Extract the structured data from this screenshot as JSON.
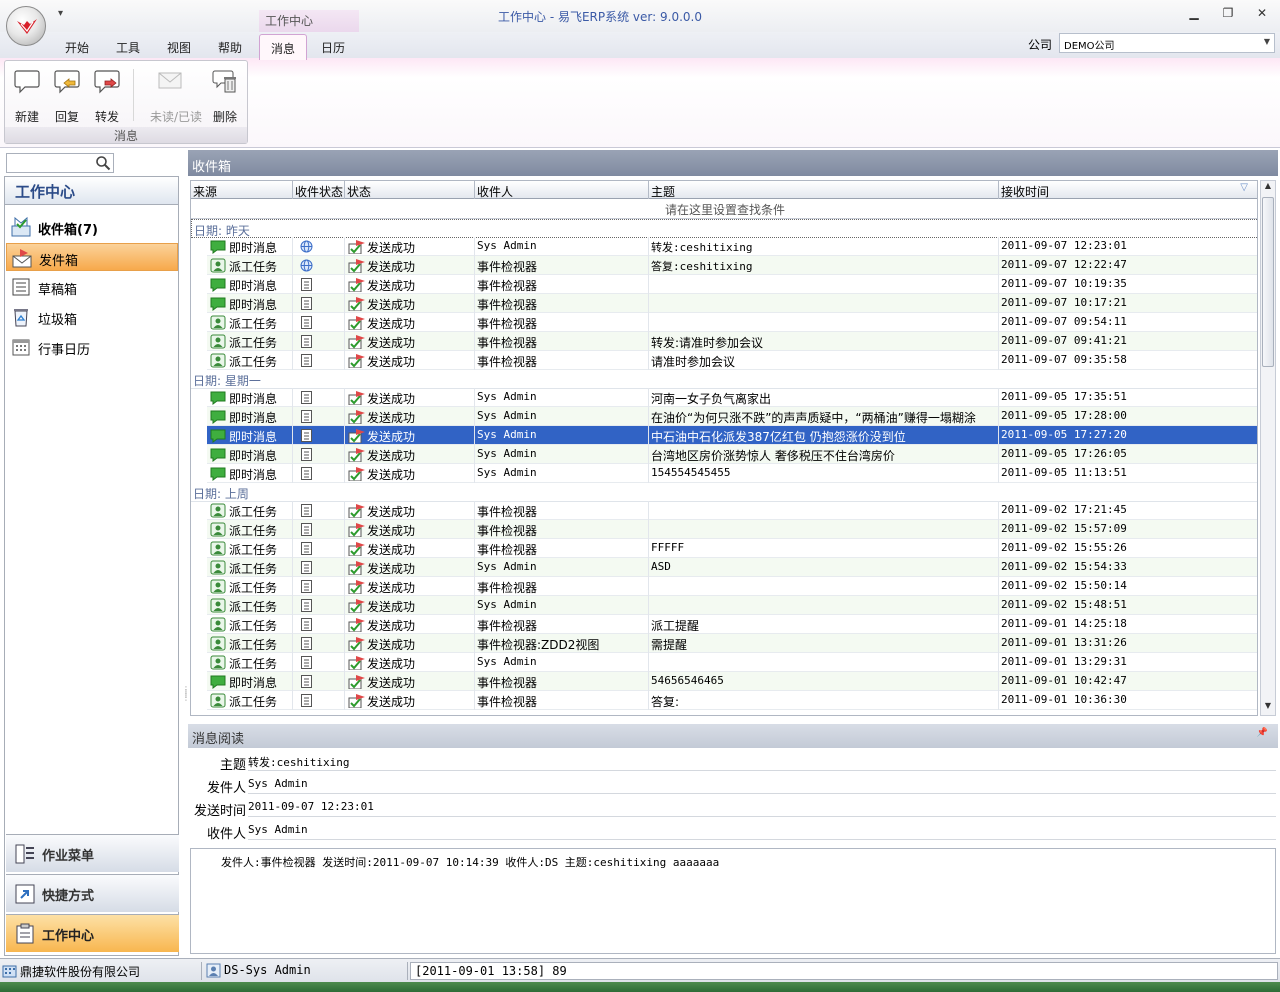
{
  "window": {
    "title": "工作中心 - 易飞ERP系统 ver: 9.0.0.0"
  },
  "ribbon": {
    "context_label": "工作中心",
    "tabs": [
      "开始",
      "工具",
      "视图",
      "帮助",
      "消息",
      "日历"
    ],
    "active_tab": "消息",
    "company_label": "公司",
    "company_value": "DEMO公司",
    "group_label": "消息",
    "buttons": {
      "new": "新建",
      "reply": "回复",
      "forward": "转发",
      "unread_read": "未读/已读",
      "delete": "删除"
    }
  },
  "nav": {
    "header": "工作中心",
    "items": [
      {
        "label": "收件箱(7)"
      },
      {
        "label": "发件箱"
      },
      {
        "label": "草稿箱"
      },
      {
        "label": "垃圾箱"
      },
      {
        "label": "行事日历"
      }
    ],
    "sections": [
      {
        "label": "作业菜单"
      },
      {
        "label": "快捷方式"
      },
      {
        "label": "工作中心"
      }
    ]
  },
  "inbox": {
    "title": "收件箱",
    "columns": [
      "来源",
      "收件状态",
      "状态",
      "收件人",
      "主题",
      "接收时间"
    ],
    "filter_hint": "请在这里设置查找条件",
    "groups": [
      {
        "label": "日期: 昨天",
        "rows": [
          {
            "src": "即时消息",
            "rs": "globe",
            "status": "发送成功",
            "receiver": "Sys Admin",
            "subject": "转发:ceshitixing",
            "time": "2011-09-07 12:23:01"
          },
          {
            "src": "派工任务",
            "rs": "globe",
            "status": "发送成功",
            "receiver": "事件检视器",
            "subject": "答复:ceshitixing",
            "time": "2011-09-07 12:22:47"
          },
          {
            "src": "即时消息",
            "rs": "doc",
            "status": "发送成功",
            "receiver": "事件检视器",
            "subject": "",
            "time": "2011-09-07 10:19:35"
          },
          {
            "src": "即时消息",
            "rs": "doc",
            "status": "发送成功",
            "receiver": "事件检视器",
            "subject": "",
            "time": "2011-09-07 10:17:21"
          },
          {
            "src": "派工任务",
            "rs": "doc",
            "status": "发送成功",
            "receiver": "事件检视器",
            "subject": "",
            "time": "2011-09-07 09:54:11"
          },
          {
            "src": "派工任务",
            "rs": "doc",
            "status": "发送成功",
            "receiver": "事件检视器",
            "subject": "转发:请准时参加会议",
            "time": "2011-09-07 09:41:21"
          },
          {
            "src": "派工任务",
            "rs": "doc",
            "status": "发送成功",
            "receiver": "事件检视器",
            "subject": "请准时参加会议",
            "time": "2011-09-07 09:35:58"
          }
        ]
      },
      {
        "label": "日期: 星期一",
        "rows": [
          {
            "src": "即时消息",
            "rs": "doc",
            "status": "发送成功",
            "receiver": "Sys Admin",
            "subject": "河南一女子负气离家出",
            "time": "2011-09-05 17:35:51"
          },
          {
            "src": "即时消息",
            "rs": "doc",
            "status": "发送成功",
            "receiver": "Sys Admin",
            "subject": "在油价“为何只涨不跌”的声声质疑中，“两桶油”赚得一塌糊涂",
            "time": "2011-09-05 17:28:00"
          },
          {
            "src": "即时消息",
            "rs": "doc",
            "status": "发送成功",
            "receiver": "Sys Admin",
            "subject": "中石油中石化派发387亿红包 仍抱怨涨价没到位",
            "time": "2011-09-05 17:27:20",
            "selected": true
          },
          {
            "src": "即时消息",
            "rs": "doc",
            "status": "发送成功",
            "receiver": "Sys Admin",
            "subject": "台湾地区房价涨势惊人 奢侈税压不住台湾房价",
            "time": "2011-09-05 17:26:05"
          },
          {
            "src": "即时消息",
            "rs": "doc",
            "status": "发送成功",
            "receiver": "Sys Admin",
            "subject": "154554545455",
            "time": "2011-09-05 11:13:51"
          }
        ]
      },
      {
        "label": "日期: 上周",
        "rows": [
          {
            "src": "派工任务",
            "rs": "doc",
            "status": "发送成功",
            "receiver": "事件检视器",
            "subject": "",
            "time": "2011-09-02 17:21:45"
          },
          {
            "src": "派工任务",
            "rs": "doc",
            "status": "发送成功",
            "receiver": "事件检视器",
            "subject": "",
            "time": "2011-09-02 15:57:09"
          },
          {
            "src": "派工任务",
            "rs": "doc",
            "status": "发送成功",
            "receiver": "事件检视器",
            "subject": "FFFFF",
            "time": "2011-09-02 15:55:26"
          },
          {
            "src": "派工任务",
            "rs": "doc",
            "status": "发送成功",
            "receiver": "Sys Admin",
            "subject": "ASD",
            "time": "2011-09-02 15:54:33"
          },
          {
            "src": "派工任务",
            "rs": "doc",
            "status": "发送成功",
            "receiver": "事件检视器",
            "subject": "",
            "time": "2011-09-02 15:50:14"
          },
          {
            "src": "派工任务",
            "rs": "doc",
            "status": "发送成功",
            "receiver": "Sys Admin",
            "subject": "",
            "time": "2011-09-02 15:48:51"
          },
          {
            "src": "派工任务",
            "rs": "doc",
            "status": "发送成功",
            "receiver": "事件检视器",
            "subject": "派工提醒",
            "time": "2011-09-01 14:25:18"
          },
          {
            "src": "派工任务",
            "rs": "doc",
            "status": "发送成功",
            "receiver": "事件检视器:ZDD2视图",
            "subject": "需提醒",
            "time": "2011-09-01 13:31:26"
          },
          {
            "src": "派工任务",
            "rs": "doc",
            "status": "发送成功",
            "receiver": "Sys Admin",
            "subject": "",
            "time": "2011-09-01 13:29:31"
          },
          {
            "src": "即时消息",
            "rs": "doc",
            "status": "发送成功",
            "receiver": "事件检视器",
            "subject": "54656546465",
            "time": "2011-09-01 10:42:47"
          },
          {
            "src": "派工任务",
            "rs": "doc",
            "status": "发送成功",
            "receiver": "事件检视器",
            "subject": "答复:",
            "time": "2011-09-01 10:36:30"
          }
        ]
      }
    ]
  },
  "reader": {
    "title": "消息阅读",
    "labels": {
      "subject": "主题",
      "sender": "发件人",
      "sent_time": "发送时间",
      "receiver": "收件人"
    },
    "subject": "转发:ceshitixing",
    "sender": "Sys Admin",
    "sent_time": "2011-09-07 12:23:01",
    "receiver": "Sys Admin",
    "body": "发件人:事件检视器 发送时间:2011-09-07 10:14:39 收件人:DS 主题:ceshitixing aaaaaaa"
  },
  "statusbar": {
    "company": "鼎捷软件股份有限公司",
    "user": "DS-Sys Admin",
    "log": "[2011-09-01 13:58] 89"
  },
  "colors": {
    "selection": "#3163c5",
    "accent_orange": "#f7a94b",
    "header_slate": "#7f8aa0"
  }
}
